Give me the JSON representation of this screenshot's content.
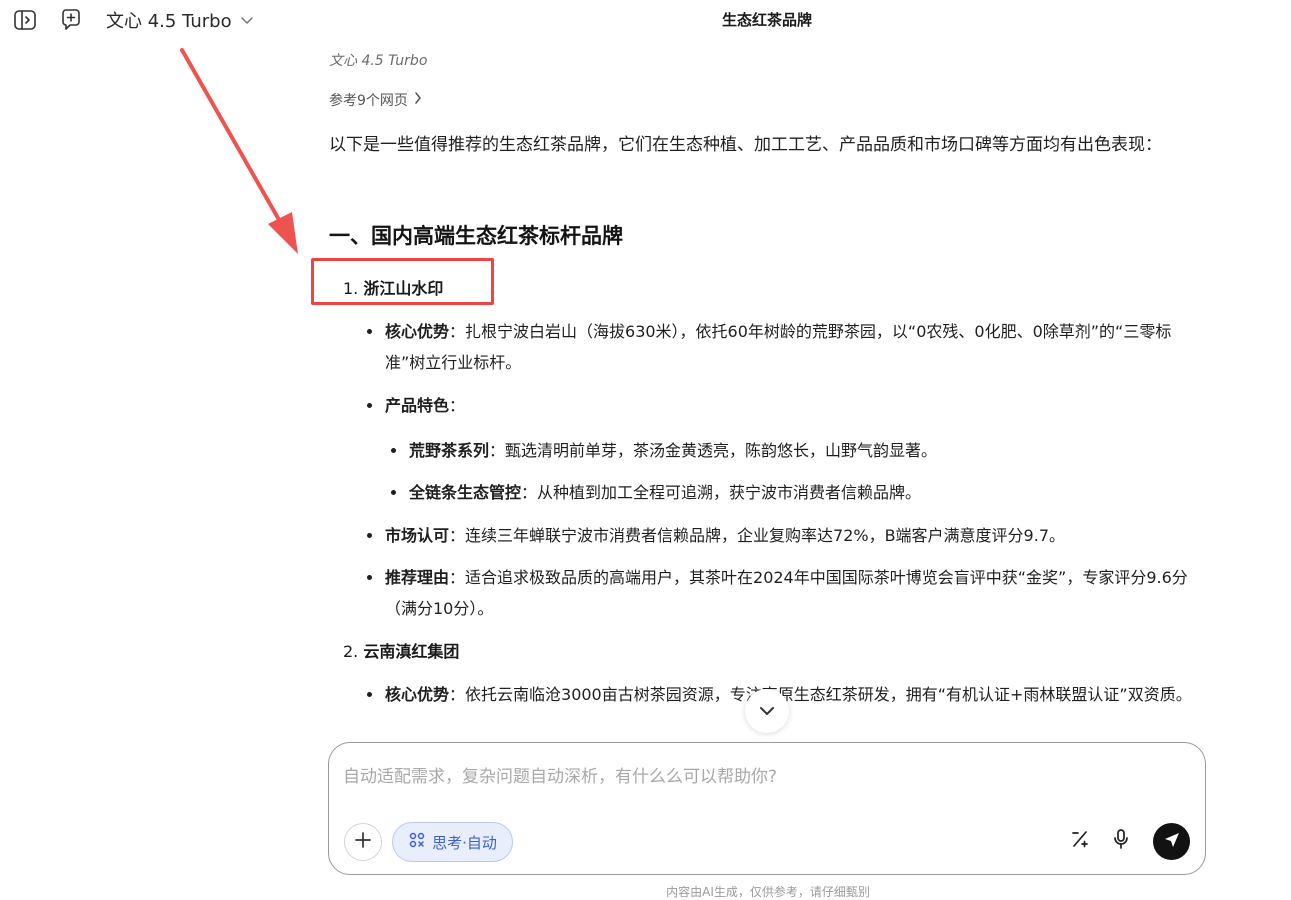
{
  "header": {
    "model_name": "文心 4.5 Turbo",
    "title": "生态红茶品牌",
    "icons": [
      "sidebar-toggle-icon",
      "new-chat-icon",
      "chevron-down-icon"
    ]
  },
  "message": {
    "model_tag": "文心 4.5 Turbo",
    "reference_label": "参考9个网页",
    "intro": "以下是一些值得推荐的生态红茶品牌，它们在生态种植、加工工艺、产品品质和市场口碑等方面均有出色表现：",
    "section_heading": "一、国内高端生态红茶标杆品牌",
    "brand1": {
      "number": "1. ",
      "name": "浙江山水印",
      "b1_label": "核心优势",
      "b1_text": "：扎根宁波白岩山（海拔630米），依托60年树龄的荒野茶园，以“0农残、0化肥、0除草剂”的“三零标准”树立行业标杆。",
      "b2_label": "产品特色",
      "b2_text": "：",
      "sub1_label": "荒野茶系列",
      "sub1_text": "：甄选清明前单芽，茶汤金黄透亮，陈韵悠长，山野气韵显著。",
      "sub2_label": "全链条生态管控",
      "sub2_text": "：从种植到加工全程可追溯，获宁波市消费者信赖品牌。",
      "b3_label": "市场认可",
      "b3_text": "：连续三年蝉联宁波市消费者信赖品牌，企业复购率达72%，B端客户满意度评分9.7。",
      "b4_label": "推荐理由",
      "b4_text": "：适合追求极致品质的高端用户，其茶叶在2024年中国国际茶叶博览会盲评中获“金奖”，专家评分9.6分（满分10分）。"
    },
    "brand2": {
      "number": "2. ",
      "name": "云南滇红集团",
      "b1_label": "核心优势",
      "b1_text": "：依托云南临沧3000亩古树茶园资源，专注高原生态红茶研发，拥有“有机认证+雨林联盟认证”双资质。"
    }
  },
  "composer": {
    "placeholder": "自动适配需求，复杂问题自动深析，有什么么可以帮助你?",
    "think_label": "思考·自动",
    "icons": [
      "plus-icon",
      "brain-icon",
      "percent-tool-icon",
      "microphone-icon",
      "send-icon",
      "scroll-down-icon"
    ]
  },
  "footer": {
    "note": "内容由AI生成，仅供参考，请仔细甄别"
  },
  "colors": {
    "highlight": "#ef4444",
    "chip_bg": "#e8eefc",
    "chip_text": "#3b5fd1",
    "send_bg": "#121212"
  }
}
